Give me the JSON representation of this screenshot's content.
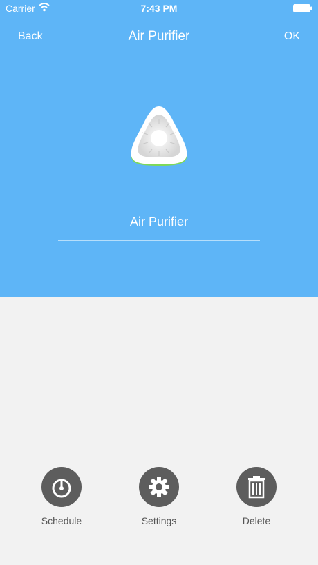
{
  "status_bar": {
    "carrier": "Carrier",
    "time": "7:43 PM",
    "wifi_icon": "wifi-icon",
    "battery_icon": "battery-icon"
  },
  "nav": {
    "back_label": "Back",
    "title": "Air Purifier",
    "ok_label": "OK"
  },
  "device": {
    "icon": "air-purifier-icon",
    "name_value": "Air Purifier"
  },
  "actions": [
    {
      "label": "Schedule",
      "icon": "clock-icon"
    },
    {
      "label": "Settings",
      "icon": "gear-icon"
    },
    {
      "label": "Delete",
      "icon": "trash-icon"
    }
  ],
  "colors": {
    "hero_background": "#5eb5f7",
    "page_background": "#f2f2f2",
    "action_circle": "#5d5d5d",
    "device_accent": "#7ed957"
  }
}
